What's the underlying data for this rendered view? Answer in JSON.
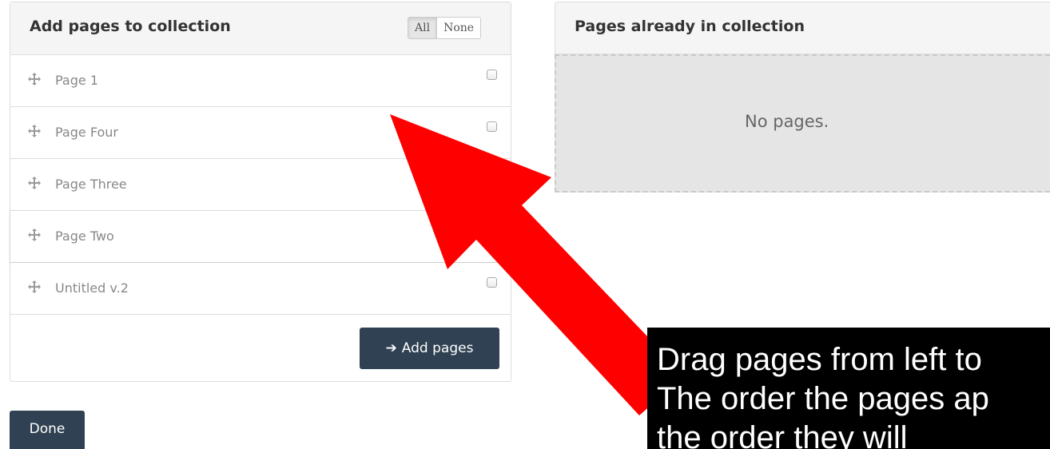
{
  "left_panel": {
    "title": "Add pages to collection",
    "select_all_label": "All",
    "select_none_label": "None",
    "pages": [
      {
        "label": "Page 1",
        "checkbox": true,
        "checked": false
      },
      {
        "label": "Page Four",
        "checkbox": true,
        "checked": false
      },
      {
        "label": "Page Three",
        "checkbox": false,
        "checked": false
      },
      {
        "label": "Page Two",
        "checkbox": false,
        "checked": false
      },
      {
        "label": "Untitled v.2",
        "checkbox": true,
        "checked": false
      }
    ],
    "add_button_label": "Add pages",
    "add_button_icon": "arrow-right-icon"
  },
  "done_button_label": "Done",
  "right_panel": {
    "title": "Pages already in collection",
    "empty_message": "No pages."
  },
  "annotation": {
    "arrow_color": "#ff0000",
    "callout_lines": [
      "Drag pages from left to",
      "The order the pages ap",
      "the order they will"
    ]
  },
  "colors": {
    "primary_button": "#2f4152",
    "panel_header": "#f5f5f5",
    "drop_zone": "#e5e5e5"
  }
}
